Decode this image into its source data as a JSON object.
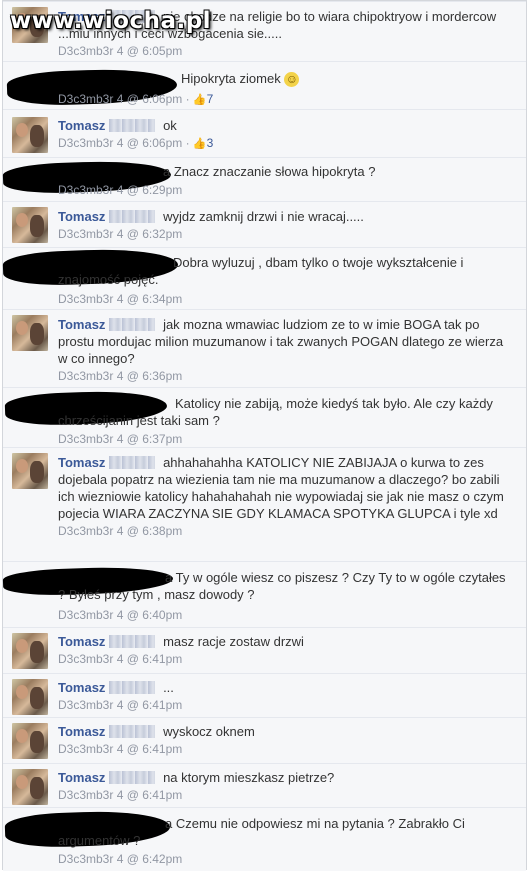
{
  "watermark": "www.wiocha.pl",
  "comments": [
    {
      "author": "Tomasz",
      "text": "nie chodze na religie bo to wiara chipoktryow i mordercow ...miu innych i ceci wzbogacenia sie.....",
      "meta": "D3c3mb3r 4 @ 6:05pm",
      "likes": ""
    },
    {
      "author": "",
      "text": "Hipokryta ziomek",
      "emoji": "☺",
      "meta": "D3c3mb3r 4 @ 6:06pm",
      "likes": "7"
    },
    {
      "author": "Tomasz",
      "text": "ok",
      "meta": "D3c3mb3r 4 @ 6:06pm",
      "likes": "3"
    },
    {
      "author": "",
      "text": "a Znacz znaczanie słowa hipokryta ?",
      "meta": "D3c3mb3r 4 @ 6:29pm",
      "likes": ""
    },
    {
      "author": "Tomasz",
      "text": "wyjdz zamknij drzwi i nie wracaj.....",
      "meta": "D3c3mb3r 4 @ 6:32pm",
      "likes": ""
    },
    {
      "author": "",
      "text": "Dobra wyluzuj , dbam tylko o twoje wykształcenie i znajomość pojęć.",
      "meta": "D3c3mb3r 4 @ 6:34pm",
      "likes": ""
    },
    {
      "author": "Tomasz",
      "text": "jak mozna wmawiac ludziom ze to w imie BOGA tak po prostu mordujac milion muzumanow i tak zwanych POGAN dlatego ze wierza w co innego?",
      "meta": "D3c3mb3r 4 @ 6:36pm",
      "likes": ""
    },
    {
      "author": "",
      "text": "Katolicy nie zabiją, może kiedyś tak było. Ale czy każdy chrześcijanin jest taki sam ?",
      "meta": "D3c3mb3r 4 @ 6:37pm",
      "likes": ""
    },
    {
      "author": "Tomasz",
      "text": "ahhahahahha KATOLICY NIE ZABIJAJA o kurwa to zes dojebala popatrz na wiezienia tam nie ma muzumanow a dlaczego? bo zabili ich wiezniowie katolicy hahahahahah nie wypowiadaj sie jak nie masz o czym pojecia WIARA ZACZYNA SIE GDY KLAMACA SPOTYKA GLUPCA i tyle xd",
      "meta": "D3c3mb3r 4 @ 6:38pm",
      "likes": ""
    },
    {
      "author": "",
      "text": "a Ty w ogóle wiesz co piszesz ? Czy Ty to w ogóle czytałes ? Byłeś przy tym , masz dowody ?",
      "meta": "D3c3mb3r 4 @ 6:40pm",
      "likes": ""
    },
    {
      "author": "Tomasz",
      "text": "masz racje zostaw drzwi",
      "meta": "D3c3mb3r 4 @ 6:41pm",
      "likes": ""
    },
    {
      "author": "Tomasz",
      "text": "...",
      "meta": "D3c3mb3r 4 @ 6:41pm",
      "likes": ""
    },
    {
      "author": "Tomasz",
      "text": "wyskocz oknem",
      "meta": "D3c3mb3r 4 @ 6:41pm",
      "likes": ""
    },
    {
      "author": "Tomasz",
      "text": "na ktorym mieszkasz pietrze?",
      "meta": "D3c3mb3r 4 @ 6:41pm",
      "likes": ""
    },
    {
      "author": "",
      "text": "a Czemu nie odpowiesz mi na pytania ? Zabrakło Ci argumentów ?",
      "meta": "D3c3mb3r 4 @ 6:42pm",
      "likes": ""
    }
  ]
}
